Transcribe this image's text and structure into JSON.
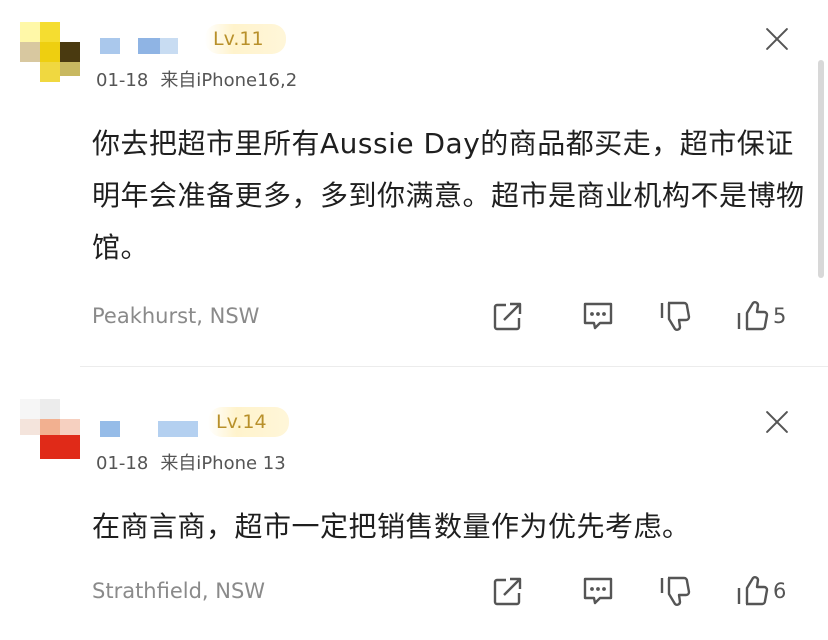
{
  "comments": [
    {
      "level": "Lv.11",
      "date": "01-18",
      "source": "来自iPhone16,2",
      "text": "你去把超市里所有Aussie Day的商品都买走，超市保证明年会准备更多，多到你满意。超市是商业机构不是博物馆。",
      "location": "Peakhurst, NSW",
      "likes": "5",
      "icons": {
        "share": "share-icon",
        "reply": "comment-icon",
        "dislike": "thumbs-down-icon",
        "like": "thumbs-up-icon",
        "close": "close-icon"
      }
    },
    {
      "level": "Lv.14",
      "date": "01-18",
      "source": "来自iPhone 13",
      "text": "在商言商，超市一定把销售数量作为优先考虑。",
      "location": "Strathfield, NSW",
      "likes": "6",
      "icons": {
        "share": "share-icon",
        "reply": "comment-icon",
        "dislike": "thumbs-down-icon",
        "like": "thumbs-up-icon",
        "close": "close-icon"
      }
    }
  ],
  "colors": {
    "text": "#1f1f1f",
    "meta": "#555555",
    "location": "#8a8a8a",
    "level_badge_text": "#b8902a",
    "level_badge_bg": "#fff3cc",
    "divider": "#ececec"
  }
}
